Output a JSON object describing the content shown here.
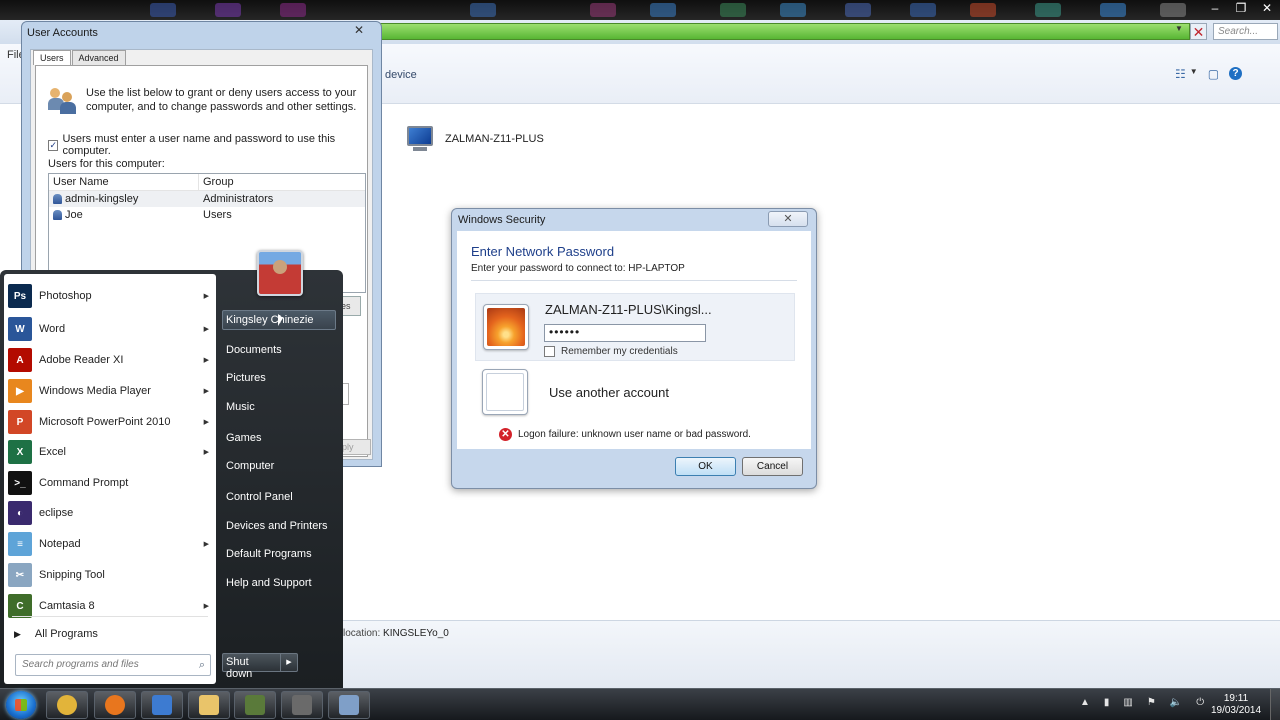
{
  "explorer": {
    "file_menu": "File",
    "breadcrumb_tail": "device",
    "search_placeholder": "Search...",
    "device_name": "ZALMAN-Z11-PLUS",
    "location_label": "location:",
    "location_value": "KINGSLEYo_0"
  },
  "user_accounts": {
    "title": "User Accounts",
    "tabs": [
      "Users",
      "Advanced"
    ],
    "intro": "Use the list below to grant or deny users access to your computer, and to change passwords and other settings.",
    "must_login_label": "Users must enter a user name and password to use this computer.",
    "must_login_checked": true,
    "users_label": "Users for this computer:",
    "columns": [
      "User Name",
      "Group"
    ],
    "rows": [
      {
        "name": "admin-kingsley",
        "group": "Administrators"
      },
      {
        "name": "Joe",
        "group": "Users"
      }
    ],
    "partial_button": "es",
    "apply_partial": "ply"
  },
  "windows_security": {
    "title": "Windows Security",
    "heading": "Enter Network Password",
    "subheading": "Enter your password to connect to: HP-LAPTOP",
    "account_name": "ZALMAN-Z11-PLUS\\Kingsl...",
    "password_mask": "••••••",
    "remember_label": "Remember my credentials",
    "another_account": "Use another account",
    "error_text": "Logon failure: unknown user name or bad password.",
    "ok_label": "OK",
    "cancel_label": "Cancel"
  },
  "start_menu": {
    "programs": [
      {
        "label": "Photoshop",
        "icon": "photoshop-icon",
        "abbr": "Ps",
        "color": "#0b2a4f",
        "submenu": true
      },
      {
        "label": "Word",
        "icon": "word-icon",
        "abbr": "W",
        "color": "#2a5699",
        "submenu": true
      },
      {
        "label": "Adobe Reader XI",
        "icon": "adobe-reader-icon",
        "abbr": "A",
        "color": "#b30b00",
        "submenu": true
      },
      {
        "label": "Windows Media Player",
        "icon": "media-player-icon",
        "abbr": "▶",
        "color": "#e8871e",
        "submenu": true
      },
      {
        "label": "Microsoft PowerPoint 2010",
        "icon": "powerpoint-icon",
        "abbr": "P",
        "color": "#d24726",
        "submenu": true
      },
      {
        "label": "Excel",
        "icon": "excel-icon",
        "abbr": "X",
        "color": "#1e7145",
        "submenu": true
      },
      {
        "label": "Command Prompt",
        "icon": "command-prompt-icon",
        "abbr": ">_",
        "color": "#111111",
        "submenu": false
      },
      {
        "label": "eclipse",
        "icon": "eclipse-icon",
        "abbr": "◐",
        "color": "#3a2a6e",
        "submenu": false
      },
      {
        "label": "Notepad",
        "icon": "notepad-icon",
        "abbr": "≡",
        "color": "#5ea4d8",
        "submenu": true
      },
      {
        "label": "Snipping Tool",
        "icon": "snipping-tool-icon",
        "abbr": "✂",
        "color": "#8aa6c1",
        "submenu": false
      },
      {
        "label": "Camtasia 8",
        "icon": "camtasia-icon",
        "abbr": "C",
        "color": "#3f6d2a",
        "submenu": true
      }
    ],
    "all_programs": "All Programs",
    "search_placeholder": "Search programs and files",
    "user_name": "Kingsley Chinezie",
    "right_items": [
      "Documents",
      "Pictures",
      "Music",
      "Games",
      "Computer",
      "Control Panel",
      "Devices and Printers",
      "Default Programs",
      "Help and Support"
    ],
    "shutdown_label": "Shut down"
  },
  "taskbar": {
    "time": "19:11",
    "date": "19/03/2014",
    "pinned": [
      "chrome-icon",
      "firefox-icon",
      "remote-desktop-icon",
      "explorer-folder-icon",
      "camtasia-recorder-icon",
      "camtasia-studio-icon",
      "user-accounts-icon"
    ]
  }
}
